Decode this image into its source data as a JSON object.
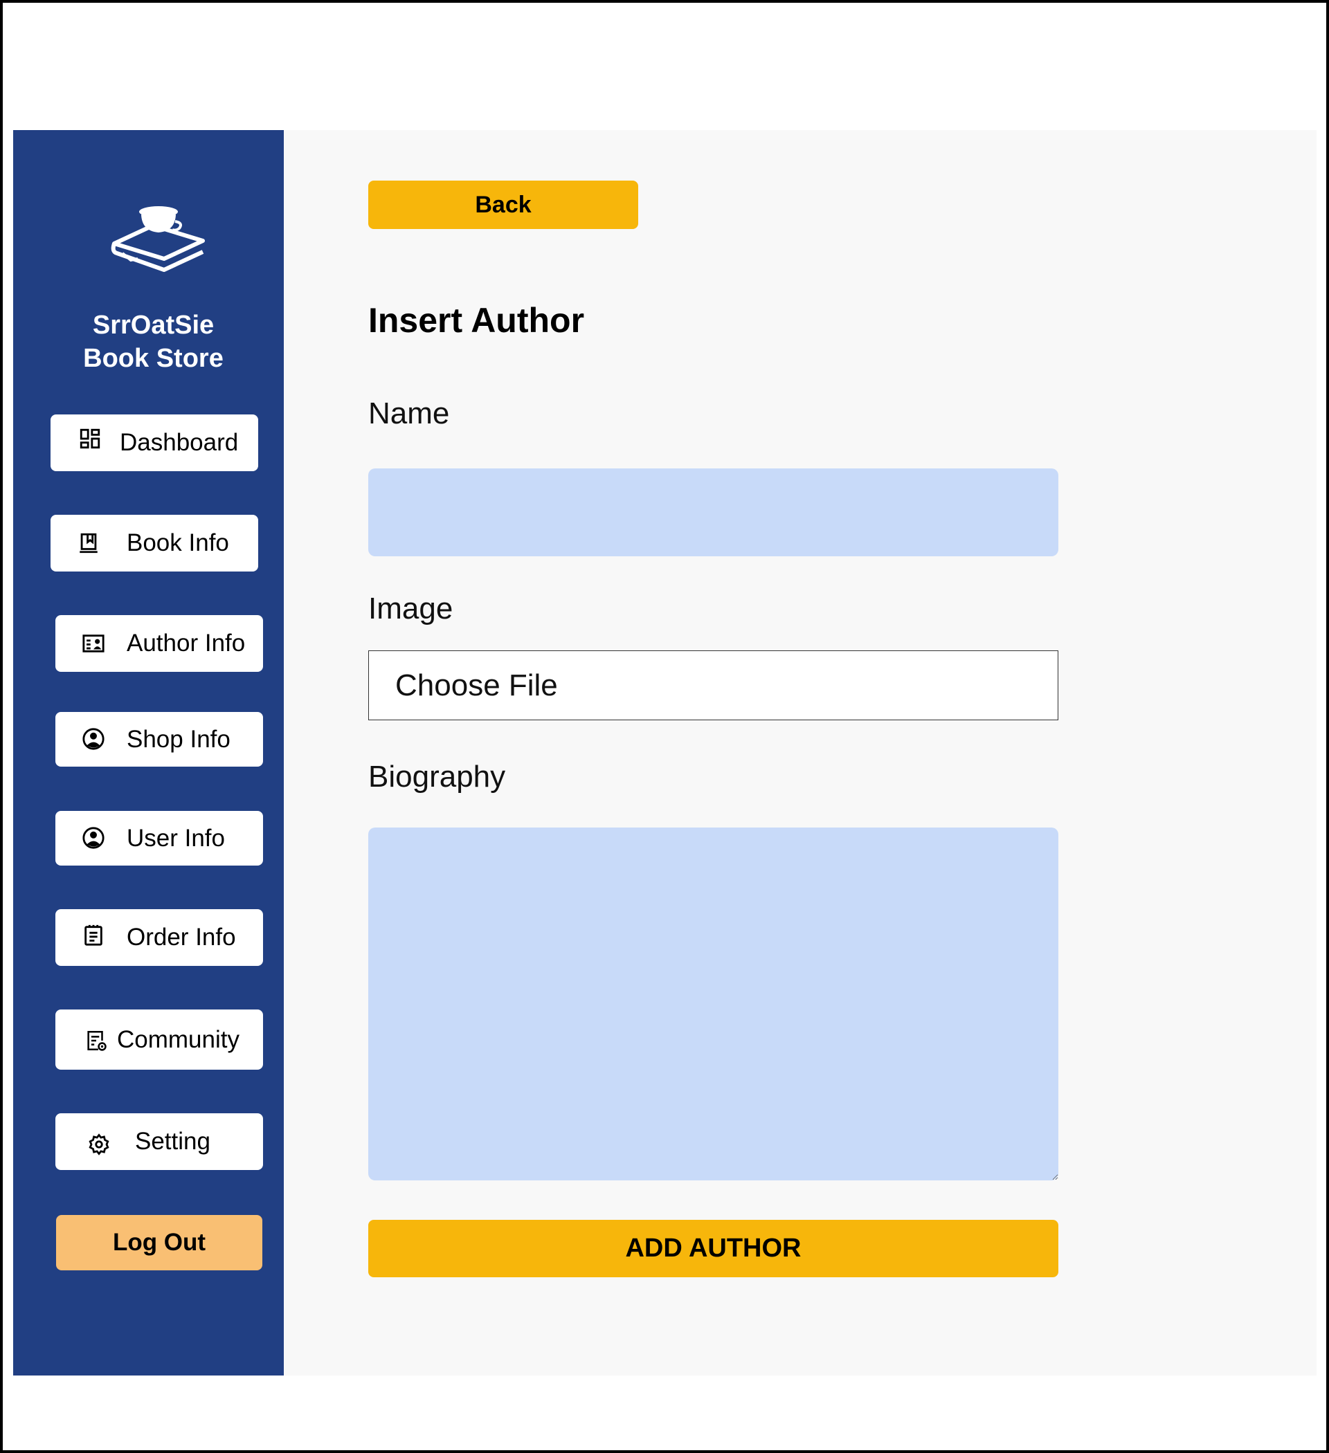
{
  "brand": {
    "line1": "SrrOatSie",
    "line2": "Book Store",
    "logo_icon": "book-and-cup-icon"
  },
  "sidebar": {
    "items": [
      {
        "label": "Dashboard",
        "icon": "dashboard-grid-icon"
      },
      {
        "label": "Book Info",
        "icon": "book-icon"
      },
      {
        "label": "Author Info",
        "icon": "contact-card-icon"
      },
      {
        "label": "Shop Info",
        "icon": "user-circle-icon"
      },
      {
        "label": "User Info",
        "icon": "user-circle-icon"
      },
      {
        "label": "Order Info",
        "icon": "clipboard-icon"
      },
      {
        "label": "Community",
        "icon": "document-settings-icon"
      },
      {
        "label": "Setting",
        "icon": "gear-icon"
      }
    ],
    "logout_label": "Log Out"
  },
  "main": {
    "back_label": "Back",
    "title": "Insert Author",
    "name_label": "Name",
    "name_value": "",
    "image_label": "Image",
    "file_button_label": "Choose File",
    "biography_label": "Biography",
    "biography_value": "",
    "submit_label": "ADD AUTHOR"
  },
  "colors": {
    "sidebar_bg": "#213f83",
    "main_bg": "#f8f8f8",
    "accent_yellow": "#f7b60b",
    "logout_orange": "#f9bf73",
    "input_blue": "#c8daf9"
  }
}
